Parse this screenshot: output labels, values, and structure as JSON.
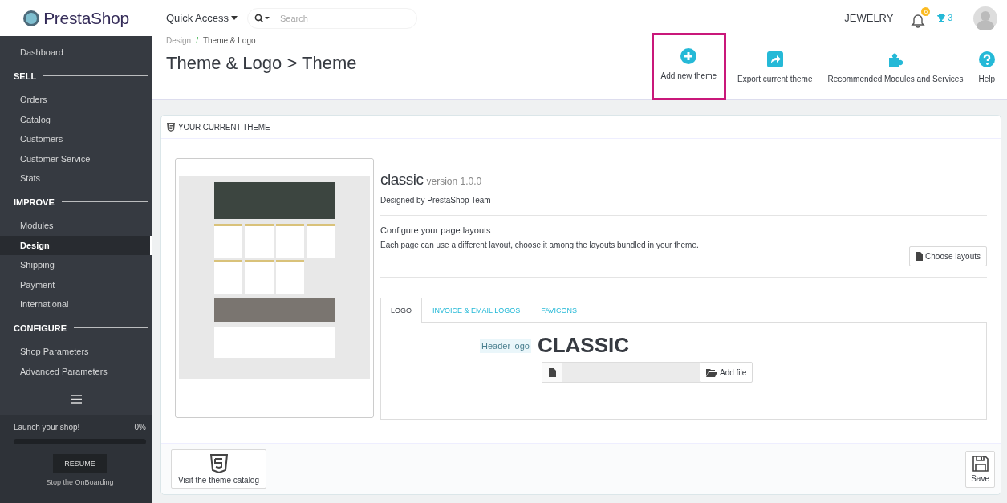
{
  "header": {
    "logo": "PrestaShop",
    "quick_access": "Quick Access",
    "search": {
      "placeholder": "Search"
    },
    "shop_name": "JEWELRY",
    "notification_count": "6",
    "trophy_count": "3"
  },
  "sidebar": {
    "items": [
      {
        "kind": "item",
        "label": "Dashboard",
        "selected": false
      },
      {
        "kind": "section",
        "label": "SELL"
      },
      {
        "kind": "item",
        "label": "Orders",
        "selected": false
      },
      {
        "kind": "item",
        "label": "Catalog",
        "selected": false
      },
      {
        "kind": "item",
        "label": "Customers",
        "selected": false
      },
      {
        "kind": "item",
        "label": "Customer Service",
        "selected": false
      },
      {
        "kind": "item",
        "label": "Stats",
        "selected": false
      },
      {
        "kind": "section",
        "label": "IMPROVE"
      },
      {
        "kind": "item",
        "label": "Modules",
        "selected": false
      },
      {
        "kind": "item",
        "label": "Design",
        "selected": true
      },
      {
        "kind": "item",
        "label": "Shipping",
        "selected": false
      },
      {
        "kind": "item",
        "label": "Payment",
        "selected": false
      },
      {
        "kind": "item",
        "label": "International",
        "selected": false
      },
      {
        "kind": "section",
        "label": "CONFIGURE"
      },
      {
        "kind": "item",
        "label": "Shop Parameters",
        "selected": false
      },
      {
        "kind": "item",
        "label": "Advanced Parameters",
        "selected": false
      }
    ],
    "onboarding": {
      "label": "Launch your shop!",
      "percent": "0%",
      "level": 0,
      "button": "RESUME",
      "stop_link": "Stop the OnBoarding"
    }
  },
  "page": {
    "breadcrumb": [
      "Design",
      "Theme & Logo"
    ],
    "breadcrumb_separator": "/",
    "title": "Theme & Logo > Theme",
    "toolbar": [
      {
        "label": "Add new theme",
        "kind": "add",
        "highlighted": true
      },
      {
        "label": "Export current theme",
        "kind": "export",
        "highlighted": false
      },
      {
        "label": "Recommended Modules and Services",
        "kind": "modules",
        "highlighted": false
      },
      {
        "label": "Help",
        "kind": "help",
        "highlighted": false
      }
    ]
  },
  "panel": {
    "heading": "YOUR CURRENT THEME",
    "theme": {
      "name": "classic",
      "version": "version 1.0.0",
      "author": "Designed by PrestaShop Team"
    },
    "layouts": {
      "title": "Configure your page layouts",
      "description": "Each page can use a different layout, choose it among the layouts bundled in your theme.",
      "button": "Choose layouts"
    },
    "tabs": [
      {
        "label": "LOGO",
        "selected": true
      },
      {
        "label": "INVOICE & EMAIL LOGOS",
        "selected": false
      },
      {
        "label": "FAVICONS",
        "selected": false
      }
    ],
    "logo_form": {
      "label": "Header logo",
      "logo_text": "CLASSIC",
      "button": "Add file"
    },
    "footer": {
      "catalog_button": "Visit the theme catalog",
      "save_button": "Save"
    }
  }
}
